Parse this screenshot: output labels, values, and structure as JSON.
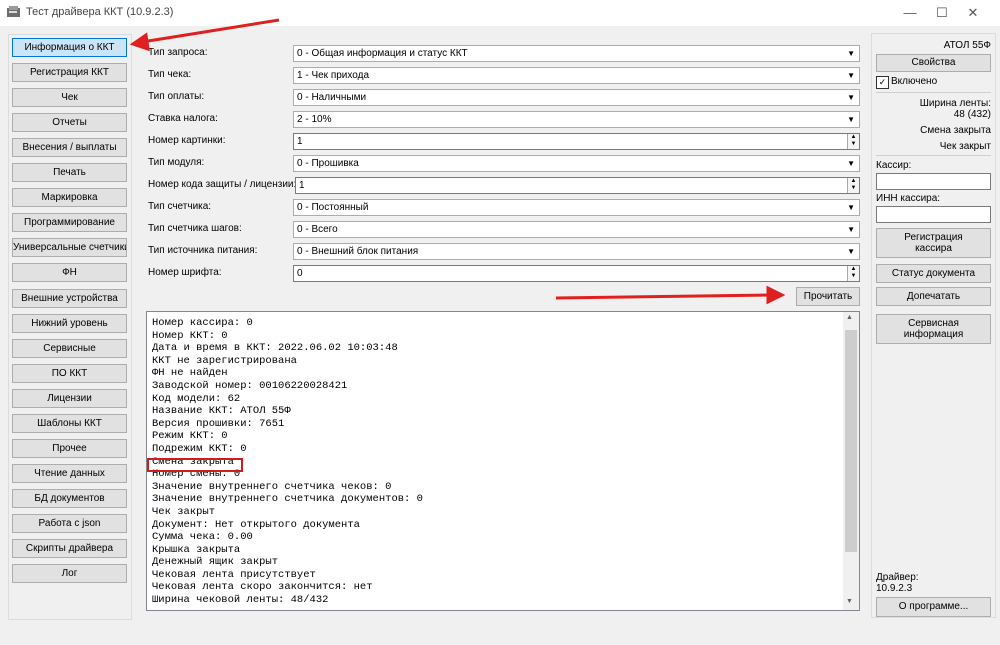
{
  "window": {
    "title": "Тест драйвера ККТ (10.9.2.3)",
    "controls": [
      "—",
      "☐",
      "✕"
    ]
  },
  "nav": {
    "items": [
      {
        "label": "Информация о ККТ",
        "active": true
      },
      {
        "label": "Регистрация ККТ"
      },
      {
        "label": "Чек"
      },
      {
        "label": "Отчеты"
      },
      {
        "label": "Внесения / выплаты"
      },
      {
        "label": "Печать"
      },
      {
        "label": "Маркировка"
      },
      {
        "label": "Программирование"
      },
      {
        "label": "Универсальные счетчики"
      },
      {
        "label": "ФН"
      },
      {
        "label": "Внешние устройства"
      },
      {
        "label": "Нижний уровень"
      },
      {
        "label": "Сервисные"
      },
      {
        "label": "ПО ККТ"
      },
      {
        "label": "Лицензии"
      },
      {
        "label": "Шаблоны ККТ"
      },
      {
        "label": "Прочее"
      },
      {
        "label": "Чтение данных"
      },
      {
        "label": "БД документов"
      },
      {
        "label": "Работа с json"
      },
      {
        "label": "Скрипты драйвера"
      },
      {
        "label": "Лог"
      }
    ]
  },
  "form": {
    "fields": [
      {
        "label": "Тип запроса:",
        "value": "0 - Общая информация и статус ККТ",
        "kind": "combo"
      },
      {
        "label": "Тип чека:",
        "value": "1 - Чек прихода",
        "kind": "combo"
      },
      {
        "label": "Тип оплаты:",
        "value": "0 - Наличными",
        "kind": "combo"
      },
      {
        "label": "Ставка налога:",
        "value": "2 - 10%",
        "kind": "combo"
      },
      {
        "label": "Номер картинки:",
        "value": "1",
        "kind": "spin"
      },
      {
        "label": "Тип модуля:",
        "value": "0 - Прошивка",
        "kind": "combo"
      },
      {
        "label": "Номер кода защиты / лицензии:",
        "value": "1",
        "kind": "spin"
      },
      {
        "label": "Тип счетчика:",
        "value": "0 - Постоянный",
        "kind": "combo"
      },
      {
        "label": "Тип счетчика шагов:",
        "value": "0 - Всего",
        "kind": "combo"
      },
      {
        "label": "Тип источника питания:",
        "value": "0 - Внешний блок питания",
        "kind": "combo"
      },
      {
        "label": "Номер шрифта:",
        "value": "0",
        "kind": "spin"
      }
    ],
    "read_button": "Прочитать"
  },
  "log": {
    "lines": [
      "Номер кассира: 0",
      "Номер ККТ: 0",
      "Дата и время в ККТ: 2022.06.02 10:03:48",
      "ККТ не зарегистрирована",
      "ФН не найден",
      "Заводской номер: 00106220028421",
      "Код модели: 62",
      "Название ККТ: АТОЛ 55Ф",
      "Версия прошивки: 7651",
      "Режим ККТ: 0",
      "Подрежим ККТ: 0",
      "Смена закрыта",
      "Номер смены: 0",
      "Значение внутреннего счетчика чеков: 0",
      "Значение внутреннего счетчика документов: 0",
      "Чек закрыт",
      "Документ: Нет открытого документа",
      "Сумма чека: 0.00",
      "Крышка закрыта",
      "Денежный ящик закрыт",
      "Чековая лента присутствует",
      "Чековая лента скоро закончится: нет",
      "Ширина чековой ленты: 48/432"
    ],
    "scroll_up": "▲",
    "scroll_down": "▼"
  },
  "right_panel": {
    "model": "АТОЛ 55Ф",
    "properties_button": "Свойства",
    "enabled_label": "Включено",
    "enabled_checked": true,
    "tape_width_label": "Ширина ленты:",
    "tape_width_value": "48 (432)",
    "shift_status": "Смена закрыта",
    "receipt_status": "Чек закрыт",
    "cashier_label": "Кассир:",
    "cashier_value": "",
    "cashier_inn_label": "ИНН кассира:",
    "cashier_inn_value": "",
    "register_cashier_button_line1": "Регистрация",
    "register_cashier_button_line2": "кассира",
    "doc_status_button": "Статус документа",
    "reprint_button": "Допечатать",
    "service_info_button_line1": "Сервисная",
    "service_info_button_line2": "информация",
    "driver_label": "Драйвер:",
    "driver_version": "10.9.2.3",
    "about_button": "О программе..."
  },
  "annotations": {
    "arrow_color": "#e02020",
    "highlight_color": "#d01c1c"
  },
  "colors": {
    "active_tab_bg": "#cce4f7",
    "active_tab_border": "#0078d7",
    "window_bg": "#f0f0f0"
  }
}
